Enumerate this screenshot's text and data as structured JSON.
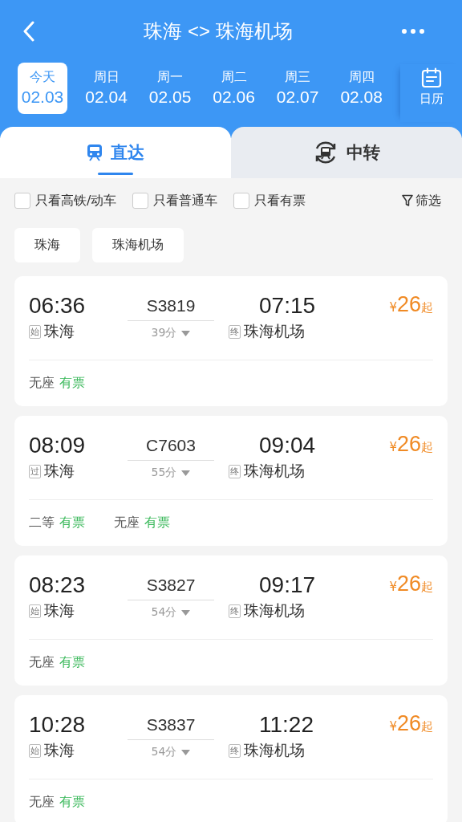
{
  "header": {
    "title": "珠海 <> 珠海机场"
  },
  "dates": [
    {
      "weekday": "今天",
      "date": "02.03",
      "selected": true
    },
    {
      "weekday": "周日",
      "date": "02.04",
      "selected": false
    },
    {
      "weekday": "周一",
      "date": "02.05",
      "selected": false
    },
    {
      "weekday": "周二",
      "date": "02.06",
      "selected": false
    },
    {
      "weekday": "周三",
      "date": "02.07",
      "selected": false
    },
    {
      "weekday": "周四",
      "date": "02.08",
      "selected": false
    }
  ],
  "calendar": {
    "label": "日历"
  },
  "tabs": [
    {
      "label": "直达",
      "kind": "direct",
      "selected": true
    },
    {
      "label": "中转",
      "kind": "transfer",
      "selected": false
    }
  ],
  "filters": [
    {
      "label": "只看高铁/动车",
      "checked": false
    },
    {
      "label": "只看普通车",
      "checked": false
    },
    {
      "label": "只看有票",
      "checked": false
    }
  ],
  "filter_button": {
    "label": "筛选"
  },
  "stations": [
    "珠海",
    "珠海机场"
  ],
  "trains": [
    {
      "depart_time": "06:36",
      "depart_tag": "始",
      "depart_station": "珠海",
      "train_no": "S3819",
      "duration": "39分",
      "arrive_time": "07:15",
      "arrive_tag": "终",
      "arrive_station": "珠海机场",
      "currency": "¥",
      "price": "26",
      "price_suffix": "起",
      "seats": [
        {
          "class": "无座",
          "status": "有票"
        }
      ]
    },
    {
      "depart_time": "08:09",
      "depart_tag": "过",
      "depart_station": "珠海",
      "train_no": "C7603",
      "duration": "55分",
      "arrive_time": "09:04",
      "arrive_tag": "终",
      "arrive_station": "珠海机场",
      "currency": "¥",
      "price": "26",
      "price_suffix": "起",
      "seats": [
        {
          "class": "二等",
          "status": "有票"
        },
        {
          "class": "无座",
          "status": "有票"
        }
      ]
    },
    {
      "depart_time": "08:23",
      "depart_tag": "始",
      "depart_station": "珠海",
      "train_no": "S3827",
      "duration": "54分",
      "arrive_time": "09:17",
      "arrive_tag": "终",
      "arrive_station": "珠海机场",
      "currency": "¥",
      "price": "26",
      "price_suffix": "起",
      "seats": [
        {
          "class": "无座",
          "status": "有票"
        }
      ]
    },
    {
      "depart_time": "10:28",
      "depart_tag": "始",
      "depart_station": "珠海",
      "train_no": "S3837",
      "duration": "54分",
      "arrive_time": "11:22",
      "arrive_tag": "终",
      "arrive_station": "珠海机场",
      "currency": "¥",
      "price": "26",
      "price_suffix": "起",
      "seats": [
        {
          "class": "无座",
          "status": "有票"
        }
      ]
    }
  ]
}
